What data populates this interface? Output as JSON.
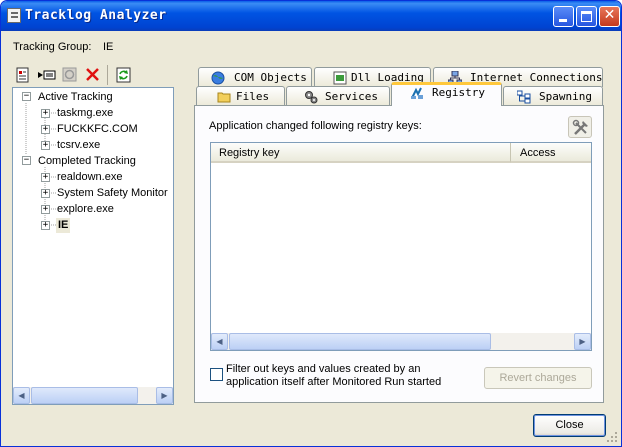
{
  "window": {
    "title": "Tracklog Analyzer"
  },
  "tracking_group": {
    "label": "Tracking Group:",
    "value": "IE"
  },
  "toolbar": {
    "icons": [
      "report-icon",
      "export-icon",
      "stop-icon",
      "delete-icon",
      "refresh-icon"
    ],
    "delete_color": "#e01010"
  },
  "tree": {
    "groups": [
      {
        "label": "Active Tracking",
        "items": [
          "taskmg.exe",
          "FUCKKFC.COM",
          "tcsrv.exe"
        ]
      },
      {
        "label": "Completed Tracking",
        "items": [
          "realdown.exe",
          "System Safety Monitor in",
          "explore.exe",
          "IE"
        ]
      }
    ],
    "selected": "IE"
  },
  "tabs": {
    "row1": [
      {
        "label": "COM Objects",
        "icon": "globe-icon"
      },
      {
        "label": "Dll Loading",
        "icon": "dll-icon"
      },
      {
        "label": "Internet Connections",
        "icon": "network-icon"
      }
    ],
    "row2": [
      {
        "label": "Files",
        "icon": "folder-icon"
      },
      {
        "label": "Services",
        "icon": "gears-icon"
      },
      {
        "label": "Registry",
        "icon": "registry-icon",
        "active": true
      },
      {
        "label": "Spawning",
        "icon": "tree-icon"
      }
    ]
  },
  "registry": {
    "description": "Application changed following registry keys:",
    "columns": [
      "Registry key",
      "Access"
    ],
    "rows": [],
    "filter_line1": "Filter out keys and values created by an",
    "filter_line2": "application itself after Monitored Run started",
    "filter_checked": false,
    "revert_label": "Revert changes"
  },
  "footer": {
    "close_label": "Close"
  },
  "colors": {
    "titlebar": "#0054e3",
    "face": "#ece9d8",
    "active_tab_accent": "#ffc83c"
  }
}
